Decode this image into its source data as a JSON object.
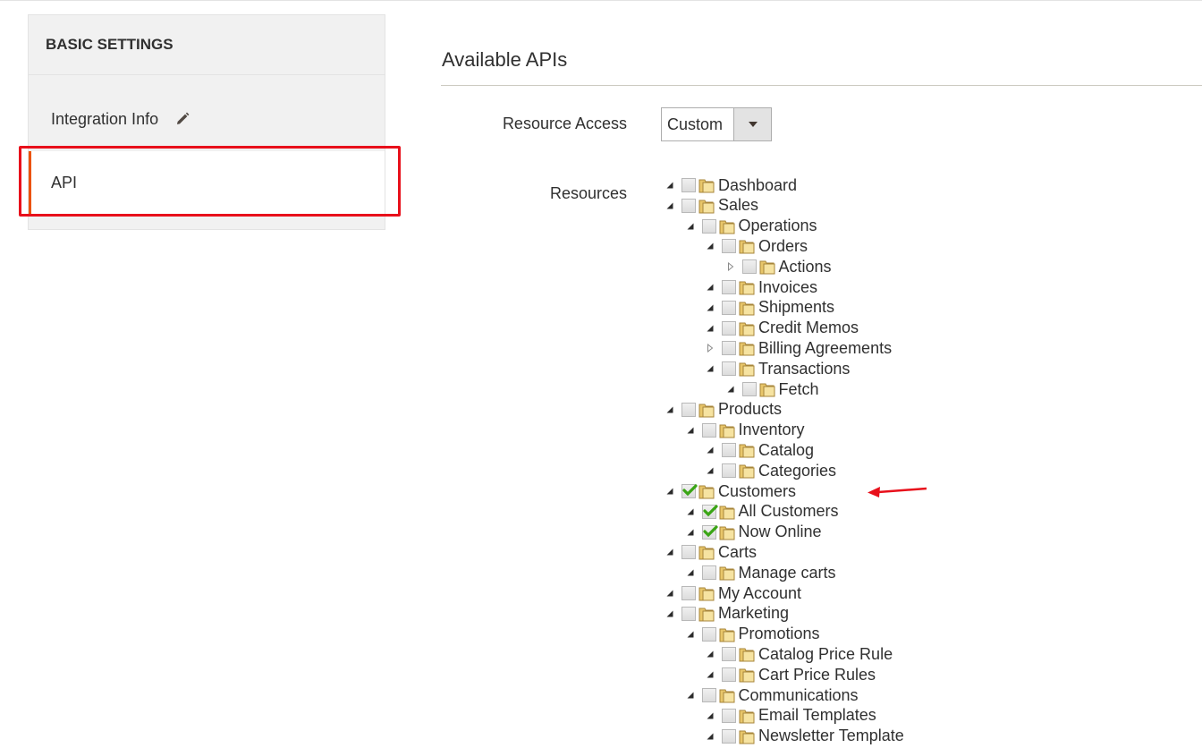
{
  "sidebar": {
    "header": "BASIC SETTINGS",
    "items": [
      {
        "label": "Integration Info",
        "icon": "pencil-icon"
      },
      {
        "label": "API"
      }
    ]
  },
  "main": {
    "section_title": "Available APIs",
    "resource_access": {
      "label": "Resource Access",
      "value": "Custom"
    },
    "resources_label": "Resources"
  },
  "tree": [
    {
      "label": "Dashboard",
      "depth": 0,
      "expanded": true,
      "checked": false
    },
    {
      "label": "Sales",
      "depth": 0,
      "expanded": true,
      "checked": false
    },
    {
      "label": "Operations",
      "depth": 1,
      "expanded": true,
      "checked": false
    },
    {
      "label": "Orders",
      "depth": 2,
      "expanded": true,
      "checked": false
    },
    {
      "label": "Actions",
      "depth": 3,
      "expanded": false,
      "checked": false
    },
    {
      "label": "Invoices",
      "depth": 2,
      "expanded": true,
      "checked": false
    },
    {
      "label": "Shipments",
      "depth": 2,
      "expanded": true,
      "checked": false
    },
    {
      "label": "Credit Memos",
      "depth": 2,
      "expanded": true,
      "checked": false
    },
    {
      "label": "Billing Agreements",
      "depth": 2,
      "expanded": false,
      "checked": false
    },
    {
      "label": "Transactions",
      "depth": 2,
      "expanded": true,
      "checked": false
    },
    {
      "label": "Fetch",
      "depth": 3,
      "expanded": true,
      "checked": false
    },
    {
      "label": "Products",
      "depth": 0,
      "expanded": true,
      "checked": false
    },
    {
      "label": "Inventory",
      "depth": 1,
      "expanded": true,
      "checked": false
    },
    {
      "label": "Catalog",
      "depth": 2,
      "expanded": true,
      "checked": false
    },
    {
      "label": "Categories",
      "depth": 2,
      "expanded": true,
      "checked": false
    },
    {
      "label": "Customers",
      "depth": 0,
      "expanded": true,
      "checked": true
    },
    {
      "label": "All Customers",
      "depth": 1,
      "expanded": true,
      "checked": true
    },
    {
      "label": "Now Online",
      "depth": 1,
      "expanded": true,
      "checked": true
    },
    {
      "label": "Carts",
      "depth": 0,
      "expanded": true,
      "checked": false
    },
    {
      "label": "Manage carts",
      "depth": 1,
      "expanded": true,
      "checked": false
    },
    {
      "label": "My Account",
      "depth": 0,
      "expanded": true,
      "checked": false
    },
    {
      "label": "Marketing",
      "depth": 0,
      "expanded": true,
      "checked": false
    },
    {
      "label": "Promotions",
      "depth": 1,
      "expanded": true,
      "checked": false
    },
    {
      "label": "Catalog Price Rule",
      "depth": 2,
      "expanded": true,
      "checked": false
    },
    {
      "label": "Cart Price Rules",
      "depth": 2,
      "expanded": true,
      "checked": false
    },
    {
      "label": "Communications",
      "depth": 1,
      "expanded": true,
      "checked": false
    },
    {
      "label": "Email Templates",
      "depth": 2,
      "expanded": true,
      "checked": false
    },
    {
      "label": "Newsletter Template",
      "depth": 2,
      "expanded": true,
      "checked": false
    }
  ],
  "annotation": {
    "color": "#e8101b"
  },
  "colors": {
    "accent": "#eb5202",
    "highlight": "#e8101b",
    "check": "#3aa515"
  }
}
